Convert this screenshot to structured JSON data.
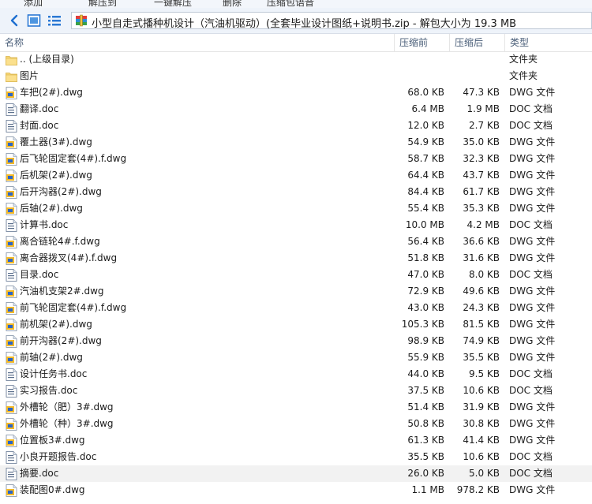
{
  "toolbar": {
    "items": [
      "添加",
      "解压到",
      "一键解压",
      "删除",
      "压缩包语音"
    ]
  },
  "address": {
    "path": "小型自走式播种机设计（汽油机驱动）(全套毕业设计图纸+说明书.zip - 解包大小为 19.3 MB"
  },
  "columns": {
    "name": "名称",
    "packed": "压缩前",
    "size": "压缩后",
    "type": "类型"
  },
  "files": [
    {
      "name": ".. (上级目录)",
      "packed": "",
      "size": "",
      "type": "文件夹",
      "icon": "folder-icon"
    },
    {
      "name": "图片",
      "packed": "",
      "size": "",
      "type": "文件夹",
      "icon": "folder-icon"
    },
    {
      "name": "车把(2#).dwg",
      "packed": "68.0 KB",
      "size": "47.3 KB",
      "type": "DWG 文件",
      "icon": "dwg-file-icon"
    },
    {
      "name": "翻译.doc",
      "packed": "6.4 MB",
      "size": "1.9 MB",
      "type": "DOC 文档",
      "icon": "doc-file-icon"
    },
    {
      "name": "封面.doc",
      "packed": "12.0 KB",
      "size": "2.7 KB",
      "type": "DOC 文档",
      "icon": "doc-file-icon"
    },
    {
      "name": "覆土器(3#).dwg",
      "packed": "54.9 KB",
      "size": "35.0 KB",
      "type": "DWG 文件",
      "icon": "dwg-file-icon"
    },
    {
      "name": "后飞轮固定套(4#).f.dwg",
      "packed": "58.7 KB",
      "size": "32.3 KB",
      "type": "DWG 文件",
      "icon": "dwg-file-icon"
    },
    {
      "name": "后机架(2#).dwg",
      "packed": "64.4 KB",
      "size": "43.7 KB",
      "type": "DWG 文件",
      "icon": "dwg-file-icon"
    },
    {
      "name": "后开沟器(2#).dwg",
      "packed": "84.4 KB",
      "size": "61.7 KB",
      "type": "DWG 文件",
      "icon": "dwg-file-icon"
    },
    {
      "name": "后轴(2#).dwg",
      "packed": "55.4 KB",
      "size": "35.3 KB",
      "type": "DWG 文件",
      "icon": "dwg-file-icon"
    },
    {
      "name": "计算书.doc",
      "packed": "10.0 MB",
      "size": "4.2 MB",
      "type": "DOC 文档",
      "icon": "doc-file-icon"
    },
    {
      "name": "离合链轮4#.f.dwg",
      "packed": "56.4 KB",
      "size": "36.6 KB",
      "type": "DWG 文件",
      "icon": "dwg-file-icon"
    },
    {
      "name": "离合器拨叉(4#).f.dwg",
      "packed": "51.8 KB",
      "size": "31.6 KB",
      "type": "DWG 文件",
      "icon": "dwg-file-icon"
    },
    {
      "name": "目录.doc",
      "packed": "47.0 KB",
      "size": "8.0 KB",
      "type": "DOC 文档",
      "icon": "doc-file-icon"
    },
    {
      "name": "汽油机支架2#.dwg",
      "packed": "72.9 KB",
      "size": "49.6 KB",
      "type": "DWG 文件",
      "icon": "dwg-file-icon"
    },
    {
      "name": "前飞轮固定套(4#).f.dwg",
      "packed": "43.0 KB",
      "size": "24.3 KB",
      "type": "DWG 文件",
      "icon": "dwg-file-icon"
    },
    {
      "name": "前机架(2#).dwg",
      "packed": "105.3 KB",
      "size": "81.5 KB",
      "type": "DWG 文件",
      "icon": "dwg-file-icon"
    },
    {
      "name": "前开沟器(2#).dwg",
      "packed": "98.9 KB",
      "size": "74.9 KB",
      "type": "DWG 文件",
      "icon": "dwg-file-icon"
    },
    {
      "name": "前轴(2#).dwg",
      "packed": "55.9 KB",
      "size": "35.5 KB",
      "type": "DWG 文件",
      "icon": "dwg-file-icon"
    },
    {
      "name": "设计任务书.doc",
      "packed": "44.0 KB",
      "size": "9.5 KB",
      "type": "DOC 文档",
      "icon": "doc-file-icon"
    },
    {
      "name": "实习报告.doc",
      "packed": "37.5 KB",
      "size": "10.6 KB",
      "type": "DOC 文档",
      "icon": "doc-file-icon"
    },
    {
      "name": "外槽轮（肥）3#.dwg",
      "packed": "51.4 KB",
      "size": "31.9 KB",
      "type": "DWG 文件",
      "icon": "dwg-file-icon"
    },
    {
      "name": "外槽轮（种）3#.dwg",
      "packed": "50.8 KB",
      "size": "30.8 KB",
      "type": "DWG 文件",
      "icon": "dwg-file-icon"
    },
    {
      "name": "位置板3#.dwg",
      "packed": "61.3 KB",
      "size": "41.4 KB",
      "type": "DWG 文件",
      "icon": "dwg-file-icon"
    },
    {
      "name": "小良开题报告.doc",
      "packed": "35.5 KB",
      "size": "10.6 KB",
      "type": "DOC 文档",
      "icon": "doc-file-icon"
    },
    {
      "name": "摘要.doc",
      "packed": "26.0 KB",
      "size": "5.0 KB",
      "type": "DOC 文档",
      "icon": "doc-file-icon",
      "highlight": true
    },
    {
      "name": "装配图0#.dwg",
      "packed": "1.1 MB",
      "size": "978.2 KB",
      "type": "DWG 文件",
      "icon": "dwg-file-icon"
    }
  ]
}
